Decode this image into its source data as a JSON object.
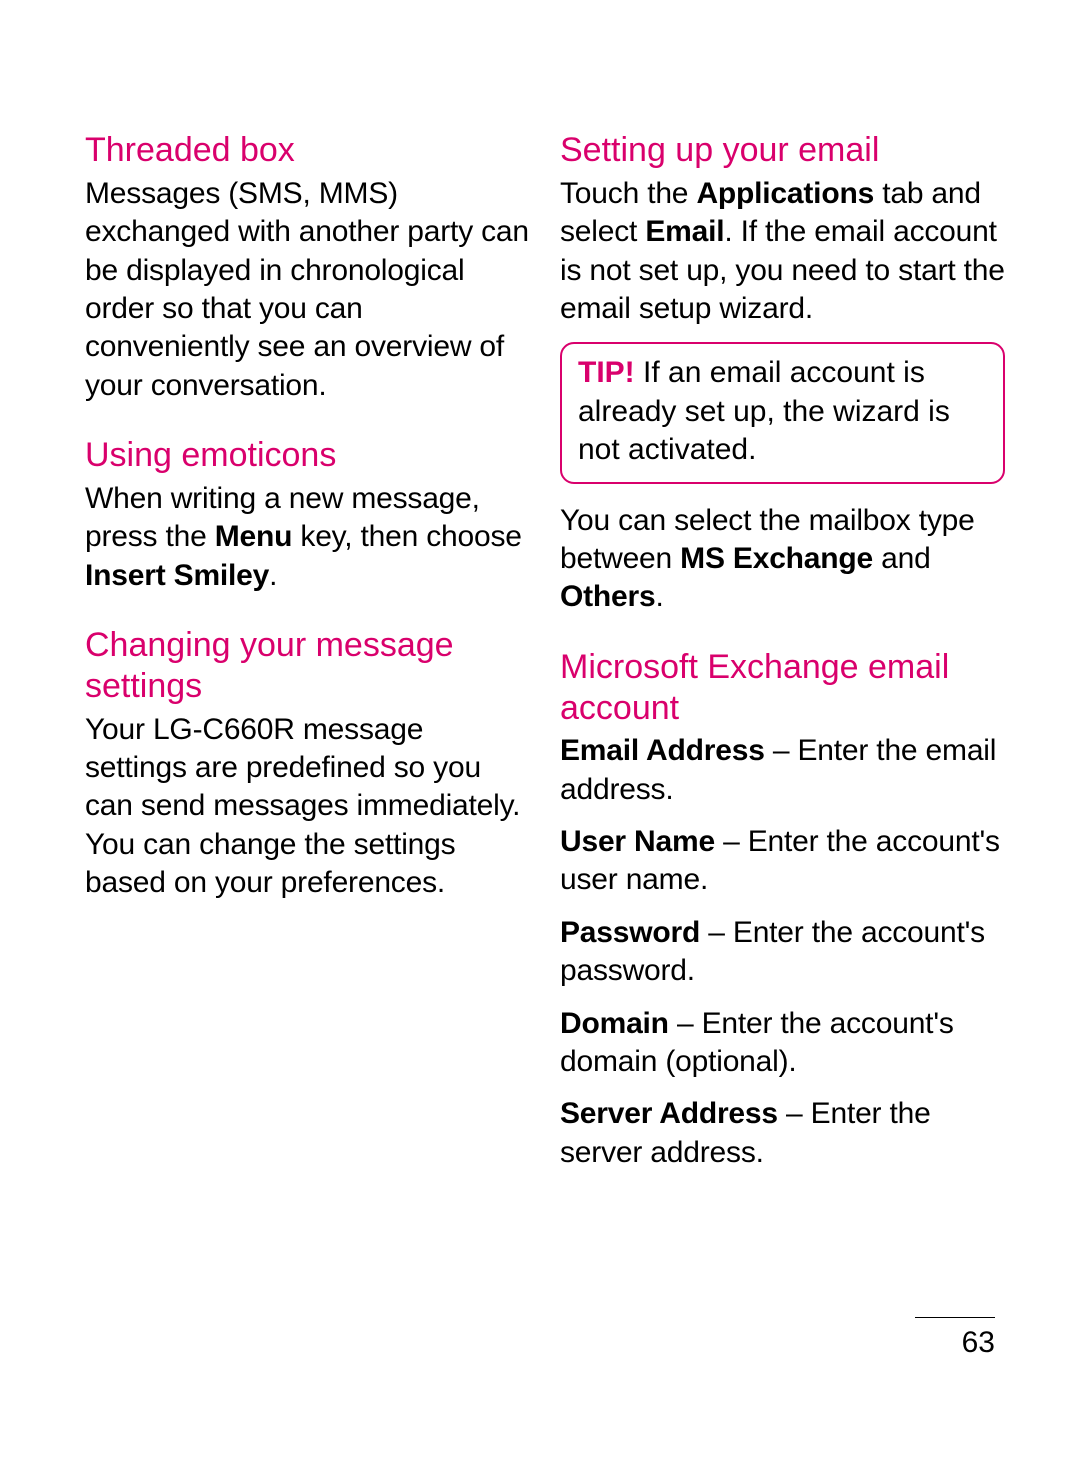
{
  "page_number": "63",
  "left": {
    "sec1": {
      "heading": "Threaded box",
      "body": "Messages (SMS, MMS) exchanged with another party can be displayed in chronological order so that you can conveniently see an overview of your conversation."
    },
    "sec2": {
      "heading": "Using emoticons",
      "body_pre": "When writing a new message, press the ",
      "body_bold1": "Menu",
      "body_mid": " key, then choose ",
      "body_bold2": "Insert Smiley",
      "body_post": "."
    },
    "sec3": {
      "heading": "Changing your message settings",
      "body": "Your LG-C660R message settings are predefined so you can send messages immediately. You can change the settings based on your preferences."
    }
  },
  "right": {
    "sec1": {
      "heading": "Setting up your email",
      "body_pre": "Touch the ",
      "body_bold1": "Applications",
      "body_mid1": " tab and select ",
      "body_bold2": "Email",
      "body_post": ". If the email account is not set up, you need to start the email setup wizard."
    },
    "tip": {
      "label": "TIP!",
      "text": " If an email account is already set up, the wizard is not activated."
    },
    "para2_pre": "You can select the mailbox type between ",
    "para2_bold1": "MS Exchange",
    "para2_mid": " and ",
    "para2_bold2": "Others",
    "para2_post": ".",
    "sec2": {
      "heading": "Microsoft Exchange email account",
      "items": [
        {
          "label": "Email Address",
          "text": " – Enter the email address."
        },
        {
          "label": "User Name",
          "text": " – Enter the account's user name."
        },
        {
          "label": "Password",
          "text": " – Enter the account's password."
        },
        {
          "label": "Domain",
          "text": " – Enter the account's domain (optional)."
        },
        {
          "label": "Server Address",
          "text": " – Enter the server address."
        }
      ]
    }
  }
}
